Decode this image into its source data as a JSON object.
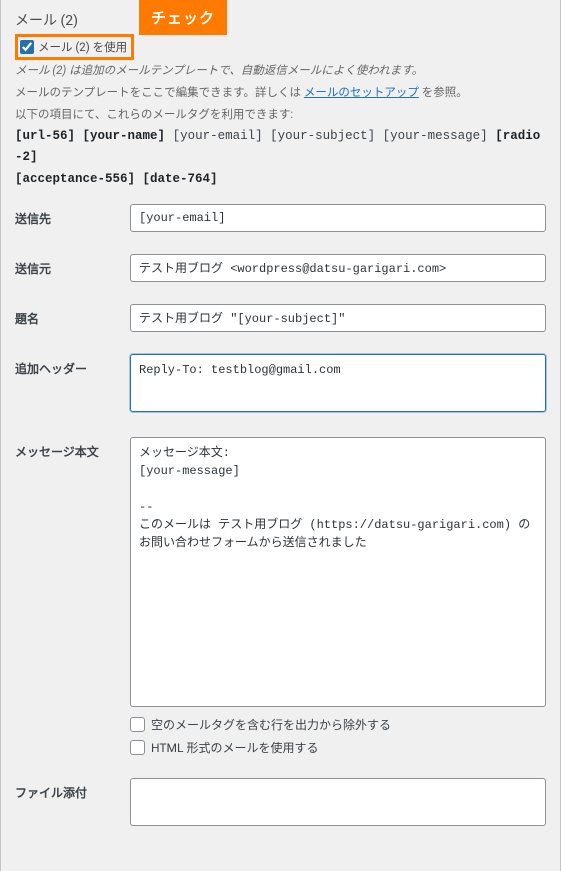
{
  "header": {
    "title": "メール (2)",
    "use_mail2_label": "メール (2) を使用",
    "use_mail2_checked": true,
    "callout_badge": "チェック",
    "desc1": "メール (2) は追加のメールテンプレートで、自動返信メールによく使われます。",
    "desc2_a": "メールのテンプレートをここで編集できます。詳しくは",
    "desc2_link": "メールのセットアップ",
    "desc2_b": "を参照。",
    "desc3": "以下の項目にて、これらのメールタグを利用できます:"
  },
  "tags": {
    "t1": "[url-56]",
    "t2": "[your-name]",
    "t3": "[your-email]",
    "t4": "[your-subject]",
    "t5": "[your-message]",
    "t6": "[radio-2]",
    "t7": "[acceptance-556]",
    "t8": "[date-764]"
  },
  "fields": {
    "to_label": "送信先",
    "to_value": "[your-email]",
    "from_label": "送信元",
    "from_value": "テスト用ブログ <wordpress@datsu-garigari.com>",
    "subject_label": "題名",
    "subject_value": "テスト用ブログ \"[your-subject]\"",
    "headers_label": "追加ヘッダー",
    "headers_value": "Reply-To: testblog@gmail.com",
    "body_label": "メッセージ本文",
    "body_value": "メッセージ本文:\n[your-message]\n\n-- \nこのメールは テスト用ブログ (https://datsu-garigari.com) のお問い合わせフォームから送信されました",
    "file_label": "ファイル添付",
    "file_value": ""
  },
  "opts": {
    "exclude_blank": "空のメールタグを含む行を出力から除外する",
    "use_html": "HTML 形式のメールを使用する"
  }
}
